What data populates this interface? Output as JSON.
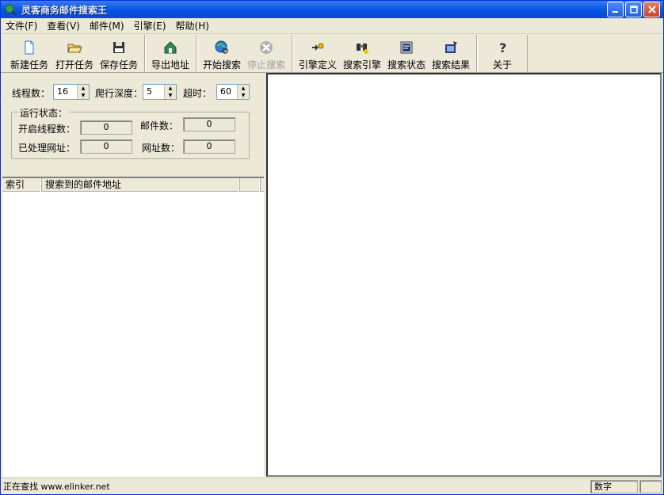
{
  "window": {
    "title": "灵客商务邮件搜索王"
  },
  "menu": [
    {
      "label": "文件(F)"
    },
    {
      "label": "查看(V)"
    },
    {
      "label": "邮件(M)"
    },
    {
      "label": "引擎(E)"
    },
    {
      "label": "帮助(H)"
    }
  ],
  "toolbar": {
    "new_task": "新建任务",
    "open_task": "打开任务",
    "save_task": "保存任务",
    "export_addr": "导出地址",
    "start_search": "开始搜索",
    "stop_search": "停止搜索",
    "engine_define": "引擎定义",
    "search_engine": "搜索引擎",
    "search_status": "搜索状态",
    "search_result": "搜索结果",
    "about": "关于"
  },
  "settings": {
    "threads_label": "线程数：",
    "threads_value": "16",
    "depth_label": "爬行深度：",
    "depth_value": "5",
    "timeout_label": "超时：",
    "timeout_value": "60"
  },
  "run_status": {
    "legend": "运行状态：",
    "open_threads_label": "开启线程数：",
    "open_threads_value": "0",
    "mail_count_label": "邮件数：",
    "mail_count_value": "0",
    "processed_label": "已处理网址：",
    "processed_value": "0",
    "url_count_label": "网址数：",
    "url_count_value": "0"
  },
  "list": {
    "columns": [
      "索引",
      "搜索到的邮件地址"
    ]
  },
  "statusbar": {
    "text": "正在查找 www.elinker.net",
    "num": "数字"
  }
}
